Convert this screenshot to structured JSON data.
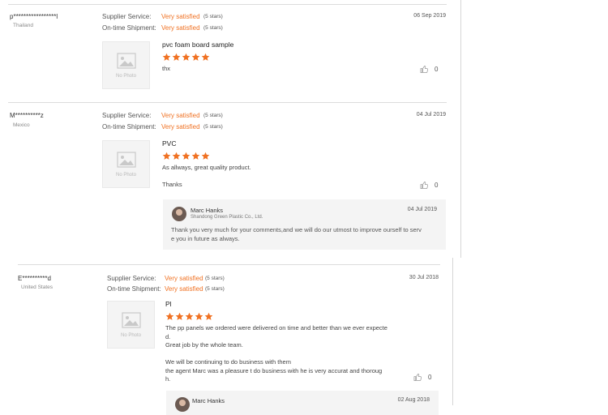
{
  "labels": {
    "supplier_service": "Supplier Service:",
    "ontime_shipment": "On-time Shipment:",
    "no_photo": "No Photo"
  },
  "reviews": [
    {
      "buyer": "p*****************l",
      "country": "Thailand",
      "date": "06 Sep 2019",
      "supplier_value": "Very satisfied",
      "supplier_stars": "(5 stars)",
      "shipment_value": "Very satisfied",
      "shipment_stars": "(5 stars)",
      "product": "pvc foam board sample",
      "rating": 5,
      "body": "thx",
      "likes": "0"
    },
    {
      "buyer": "M**********z",
      "country": "Mexico",
      "date": "04 Jul 2019",
      "supplier_value": "Very satisfied",
      "supplier_stars": "(5 stars)",
      "shipment_value": "Very satisfied",
      "shipment_stars": "(5 stars)",
      "product": "PVC",
      "rating": 5,
      "body": "As allways, great quality product.\n\nThanks",
      "likes": "0",
      "reply": {
        "name": "Marc Hanks",
        "company": "Shandong Green Plastic Co., Ltd.",
        "date": "04 Jul 2019",
        "text": "Thank you very much for your comments,and we will do our utmost to improve ourself to serv\ne you in future as always."
      }
    },
    {
      "buyer": "E**********d",
      "country": "United States",
      "date": "30 Jul 2018",
      "supplier_value": "Very satisfied",
      "supplier_stars": "(5 stars)",
      "shipment_value": "Very satisfied",
      "shipment_stars": "(5 stars)",
      "product": "Pl",
      "rating": 5,
      "body": "The pp panels we ordered were delivered on time and better than we ever expecte\nd.\nGreat job by the whole team.\n\nWe will be continuing to do business with them\nthe agent Marc was a pleasure t do business with he is very accurat and thoroug\nh.",
      "likes": "0",
      "reply": {
        "name": "Marc Hanks",
        "date": "02 Aug 2018"
      }
    }
  ],
  "colors": {
    "accent": "#f07122",
    "star": "#f07122"
  },
  "icons": {
    "star": "star-icon",
    "like": "thumbs-up-icon",
    "photo": "image-placeholder-icon"
  }
}
